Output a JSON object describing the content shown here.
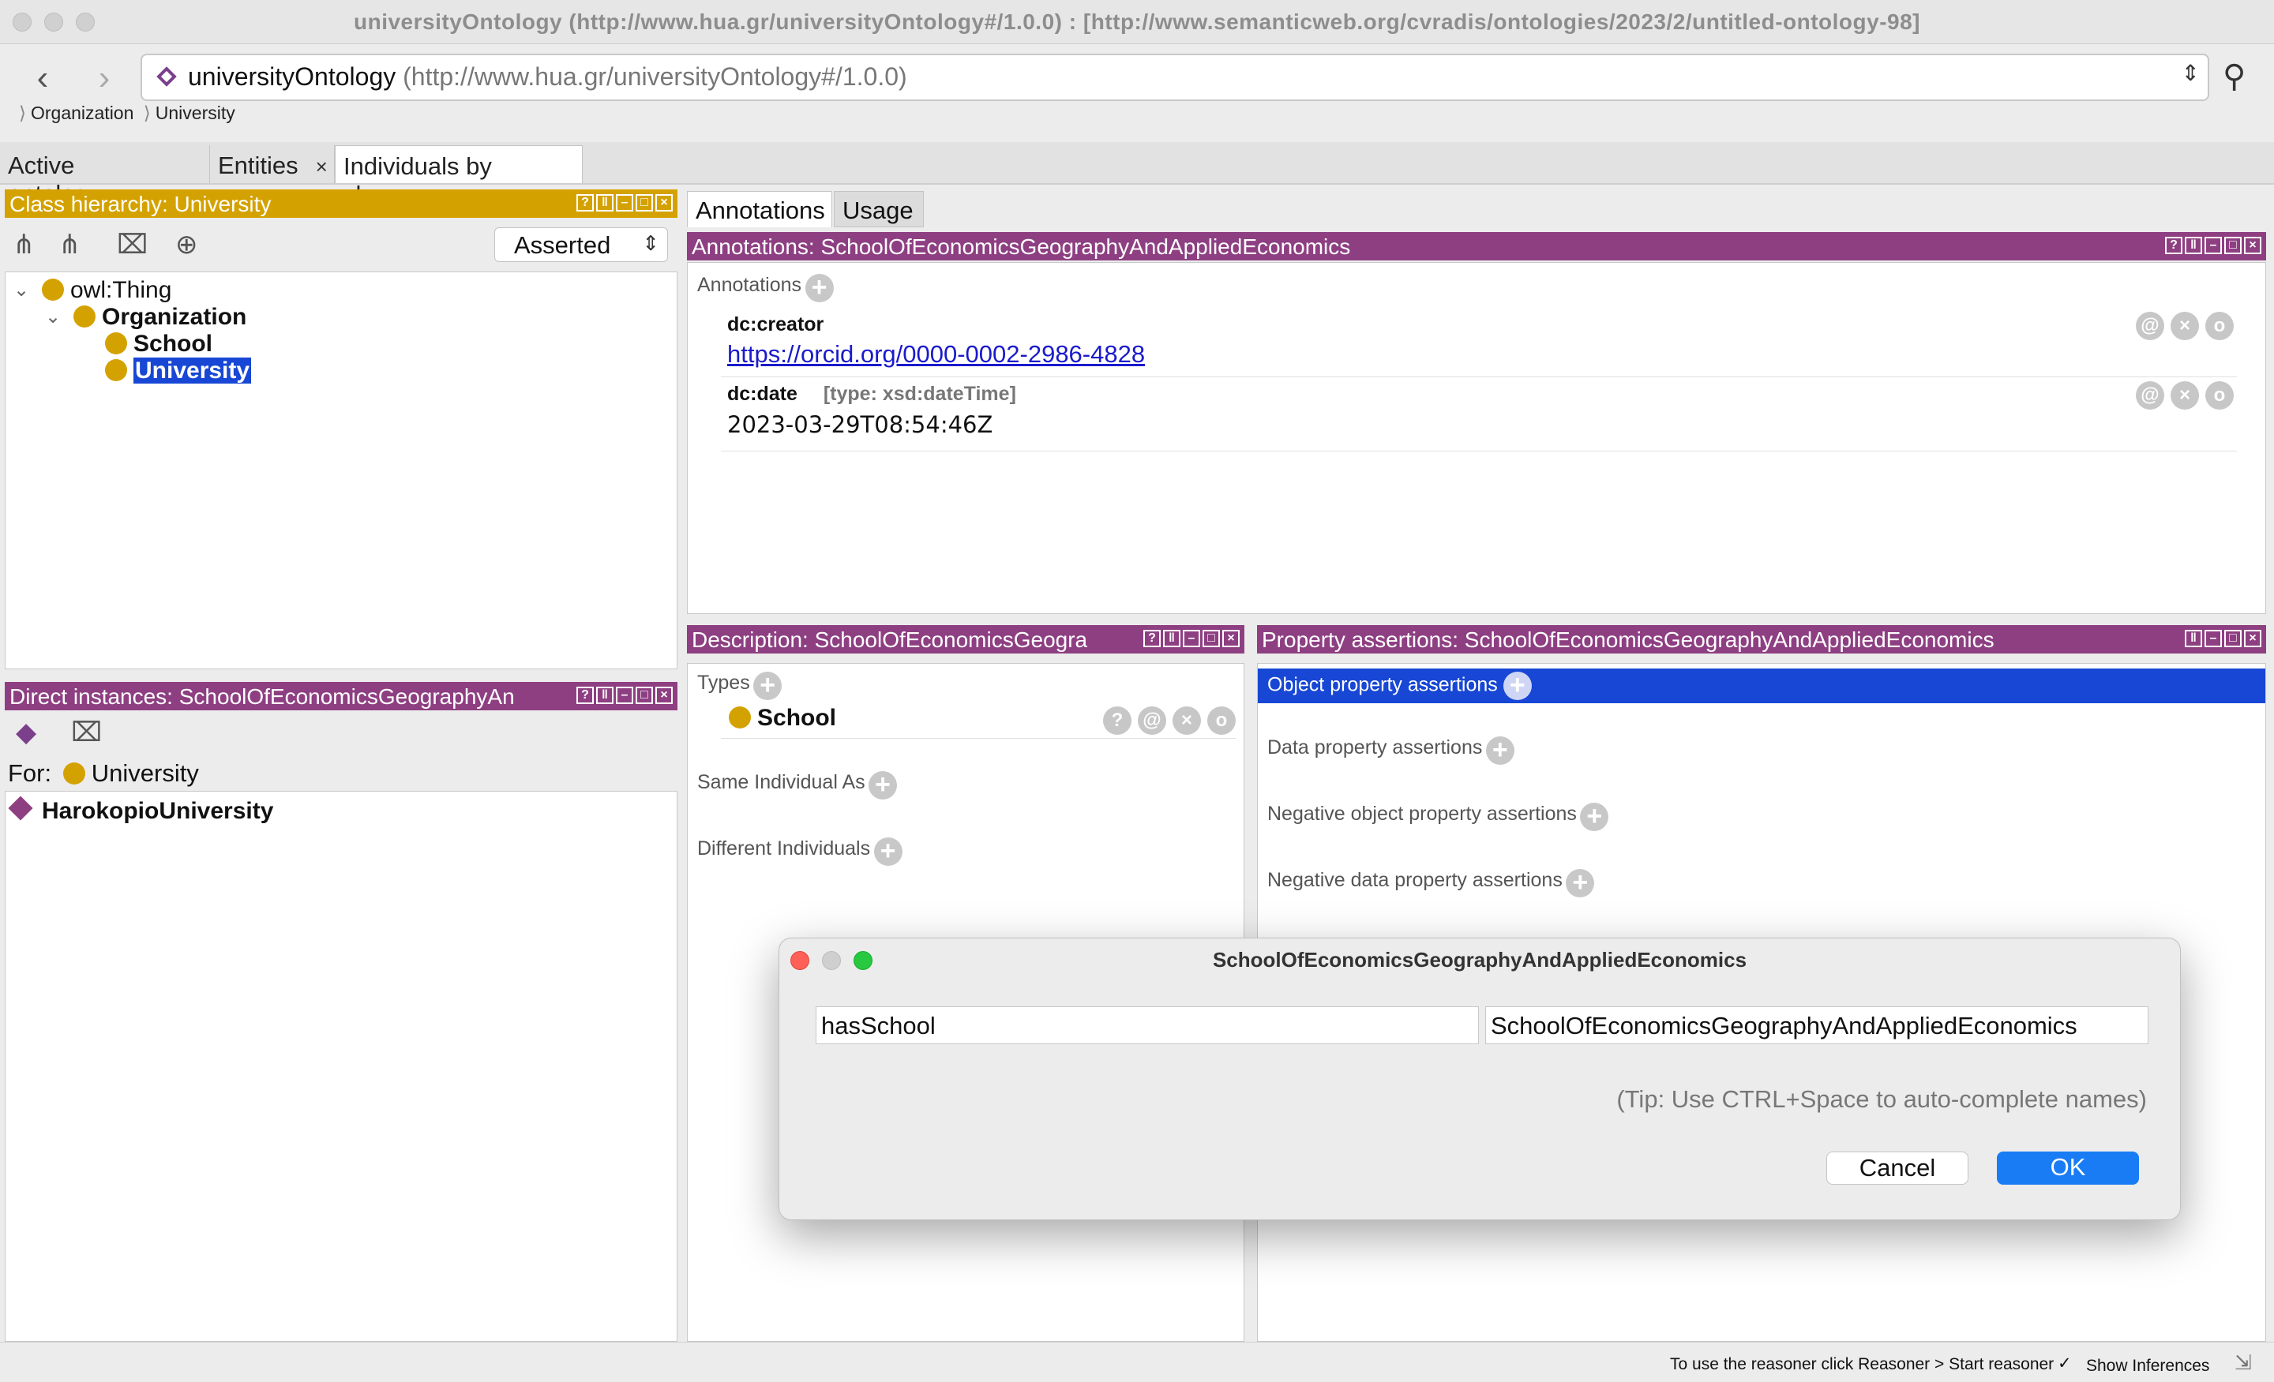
{
  "window": {
    "title": "universityOntology (http://www.hua.gr/universityOntology#/1.0.0)  : [http://www.semanticweb.org/cvradis/ontologies/2023/2/untitled-ontology-98]"
  },
  "nav": {
    "ontology_name": "universityOntology",
    "ontology_iri": "(http://www.hua.gr/universityOntology#/1.0.0)",
    "breadcrumb": [
      "Organization",
      "University"
    ]
  },
  "tabs": [
    {
      "label": "Active ontology",
      "close": "×"
    },
    {
      "label": "Entities",
      "close": "×"
    },
    {
      "label": "Individuals by class",
      "close": "×"
    }
  ],
  "class_hierarchy": {
    "header": "Class hierarchy: University",
    "mode": "Asserted",
    "tree": [
      "owl:Thing",
      "Organization",
      "School",
      "University"
    ]
  },
  "direct_instances": {
    "header": "Direct instances: SchoolOfEconomicsGeographyAn",
    "for_label": "For:",
    "for_class": "University",
    "items": [
      "HarokopioUniversity"
    ]
  },
  "right_tabs": [
    "Annotations",
    "Usage"
  ],
  "annotations": {
    "header": "Annotations: SchoolOfEconomicsGeographyAndAppliedEconomics",
    "section_label": "Annotations",
    "items": [
      {
        "property": "dc:creator",
        "type": "",
        "value": "https://orcid.org/0000-0002-2986-4828"
      },
      {
        "property": "dc:date",
        "type": "[type: xsd:dateTime]",
        "value": "2023-03-29T08:54:46Z"
      }
    ]
  },
  "description": {
    "header": "Description: SchoolOfEconomicsGeogra",
    "types_label": "Types",
    "type_value": "School",
    "same_label": "Same Individual As",
    "different_label": "Different Individuals"
  },
  "property_assertions": {
    "header": "Property assertions: SchoolOfEconomicsGeographyAndAppliedEconomics",
    "sections": [
      "Object property assertions",
      "Data property assertions",
      "Negative object property assertions",
      "Negative data property assertions"
    ]
  },
  "dialog": {
    "title": "SchoolOfEconomicsGeographyAndAppliedEconomics",
    "property_value": "hasSchool",
    "individual_value": "SchoolOfEconomicsGeographyAndAppliedEconomics",
    "tip": "(Tip: Use CTRL+Space to auto-complete names)",
    "cancel_label": "Cancel",
    "ok_label": "OK"
  },
  "statusbar": {
    "reasoner_text": "To use the reasoner click Reasoner > Start reasoner",
    "show_inferences_label": "Show Inferences",
    "checkbox_mark": "✓"
  },
  "colors": {
    "class_header": "#d4a200",
    "individual_header": "#8e3f82",
    "selection": "#1747d4",
    "ok_button": "#1a7cf5"
  }
}
